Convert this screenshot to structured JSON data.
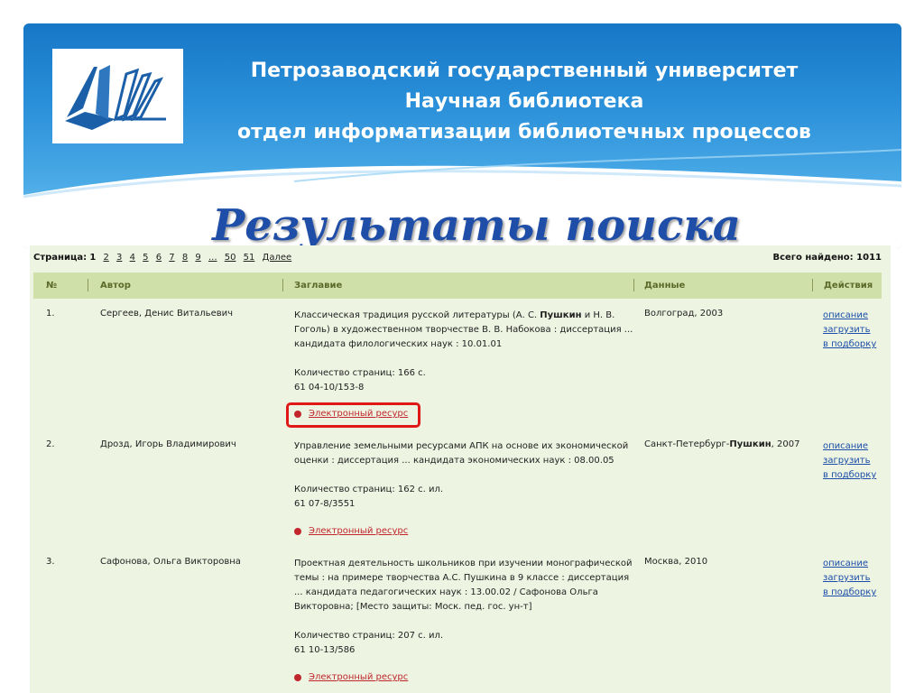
{
  "header": {
    "line1": "Петрозаводский государственный университет",
    "line2": "Научная библиотека",
    "line3": "отдел информатизации библиотечных процессов"
  },
  "slide_title": "Результаты поиска",
  "pager": {
    "label": "Страница:",
    "current": "1",
    "pages": [
      "2",
      "3",
      "4",
      "5",
      "6",
      "7",
      "8",
      "9",
      "...",
      "50",
      "51"
    ],
    "next": "Далее"
  },
  "total": "Всего найдено: 1011",
  "columns": {
    "num": "№",
    "author": "Автор",
    "title": "Заглавие",
    "data": "Данные",
    "actions": "Действия"
  },
  "results": [
    {
      "num": "1.",
      "author": "Сергеев, Денис Витальевич",
      "title_pre": "Классическая традиция русской литературы (А. С. ",
      "title_bold": "Пушкин",
      "title_post": " и Н. В. Гоголь) в художественном творчестве В. В. Набокова : диссертация ... кандидата филологических наук : 10.01.01",
      "pages": "Количество страниц: 166 с.",
      "code": "61 04-10/153-8",
      "data_pre": "Волгоград, 2003",
      "data_bold": "",
      "data_post": "",
      "eresource": "Электронный ресурс"
    },
    {
      "num": "2.",
      "author": "Дрозд, Игорь Владимирович",
      "title_pre": "Управление земельными ресурсами АПК на основе их экономической оценки : диссертация ... кандидата экономических наук : 08.00.05",
      "title_bold": "",
      "title_post": "",
      "pages": "Количество страниц: 162 с. ил.",
      "code": "61 07-8/3551",
      "data_pre": "Санкт-Петербург-",
      "data_bold": "Пушкин",
      "data_post": ", 2007",
      "eresource": "Электронный ресурс"
    },
    {
      "num": "3.",
      "author": "Сафонова, Ольга Викторовна",
      "title_pre": "Проектная деятельность школьников при изучении монографической темы : на примере творчества А.С. Пушкина в 9 классе : диссертация ... кандидата педагогических наук : 13.00.02 / Сафонова Ольга Викторовна; [Место защиты: Моск. пед. гос. ун-т]",
      "title_bold": "",
      "title_post": "",
      "pages": "Количество страниц: 207 с. ил.",
      "code": "61 10-13/586",
      "data_pre": "Москва, 2010",
      "data_bold": "",
      "data_post": "",
      "eresource": "Электронный ресурс"
    }
  ],
  "actions": {
    "describe": "описание",
    "download": "загрузить",
    "add": "в подборку"
  },
  "colors": {
    "banner": "#2a8fd9",
    "panel": "#eef4e2",
    "header_row": "#cfe0a8",
    "link": "#1a4ea8",
    "resource": "#c0262c",
    "highlight": "#e01818"
  },
  "icons": [
    "library-book-logo",
    "red-dot-icon"
  ]
}
